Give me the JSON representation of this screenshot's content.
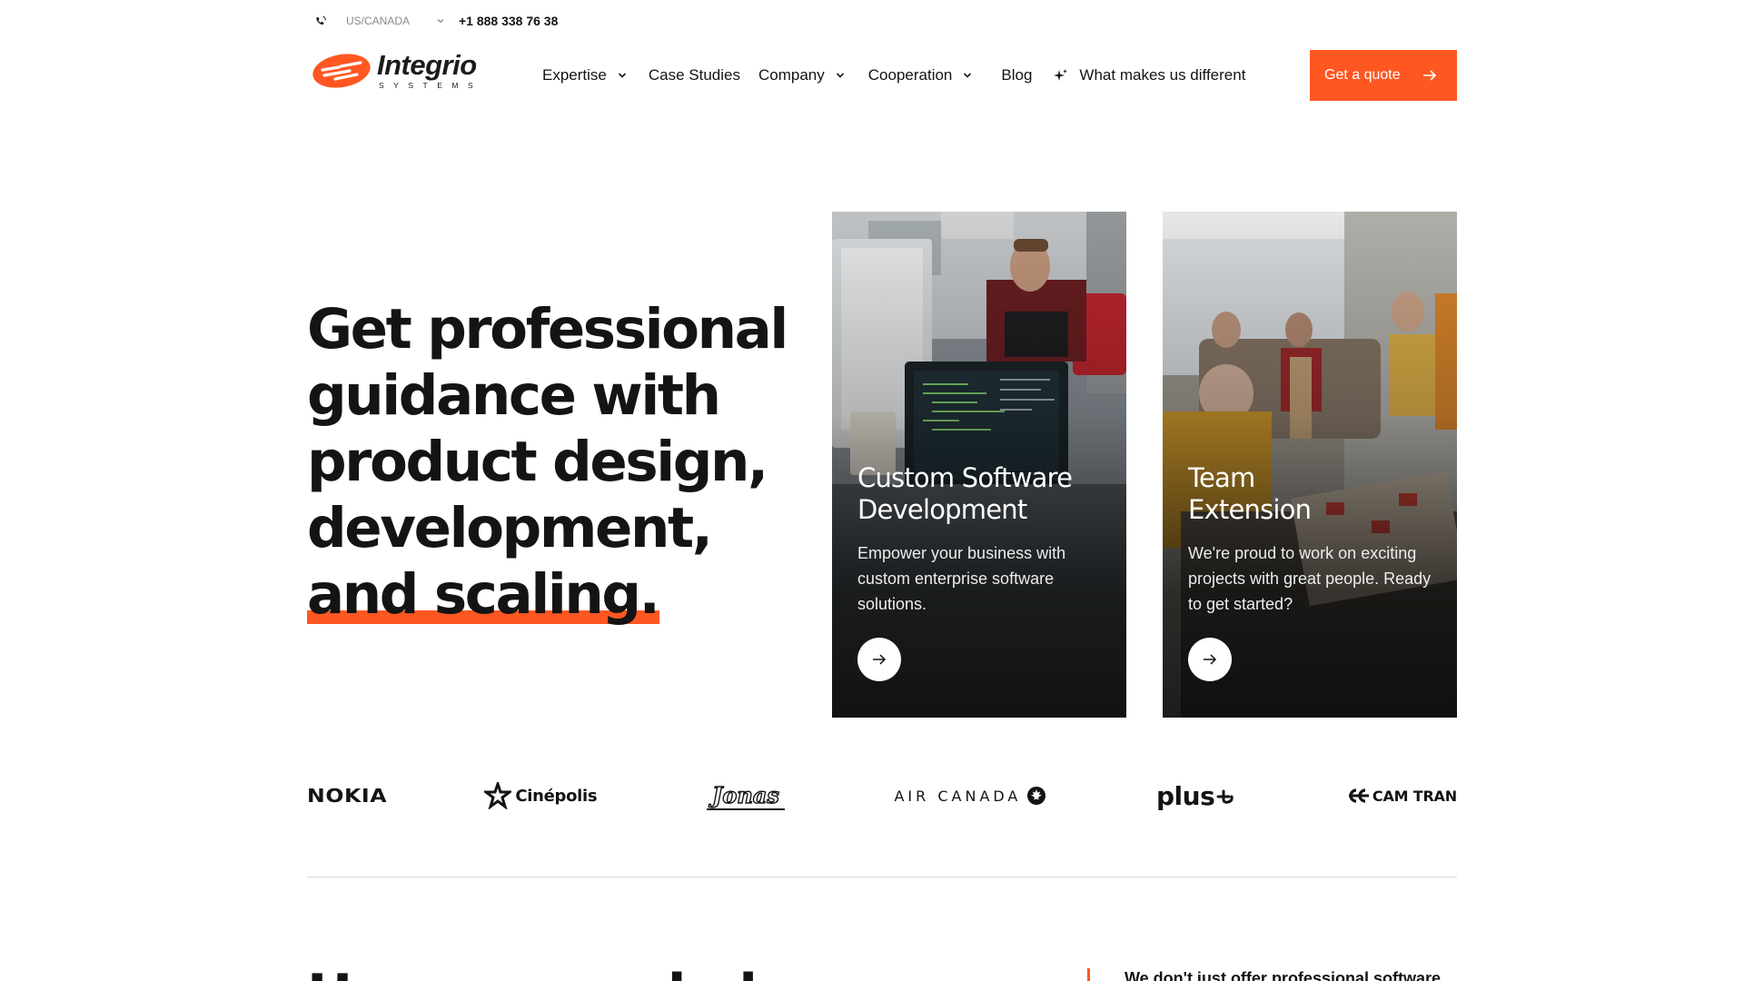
{
  "topbar": {
    "phone_icon": "phone-icon",
    "region": "US/CANADA",
    "phone": "+1 888 338 76 38"
  },
  "brand": {
    "name": "Integrio",
    "sub": "SYSTEMS",
    "accent": "#ff5722"
  },
  "nav": {
    "expertise": "Expertise",
    "case_studies": "Case Studies",
    "company": "Company",
    "cooperation": "Cooperation",
    "blog": "Blog",
    "different": "What makes us different",
    "quote": "Get a quote"
  },
  "hero": {
    "line1": "Get professional",
    "line2": "guidance with",
    "line3": "product design,",
    "line4": "development,",
    "line5": "and scaling."
  },
  "cards": [
    {
      "title_1": "Custom Software",
      "title_2": "Development",
      "text": "Empower your business with custom enterprise software solutions.",
      "icon": "arrow-right-icon"
    },
    {
      "title_1": "Team",
      "title_2": "Extension",
      "text": "We're proud to work on exciting projects with great people. Ready to get started?",
      "icon": "arrow-right-icon"
    }
  ],
  "clients": {
    "nokia": "NOKIA",
    "cinepolis": "Cinépolis",
    "jonas": "Jonas",
    "air_canada": "AIR CANADA",
    "plus": "plus",
    "camtran": "CAM TRAN"
  },
  "section": {
    "title": "How we can help",
    "side_text": "We don't just offer professional software"
  }
}
